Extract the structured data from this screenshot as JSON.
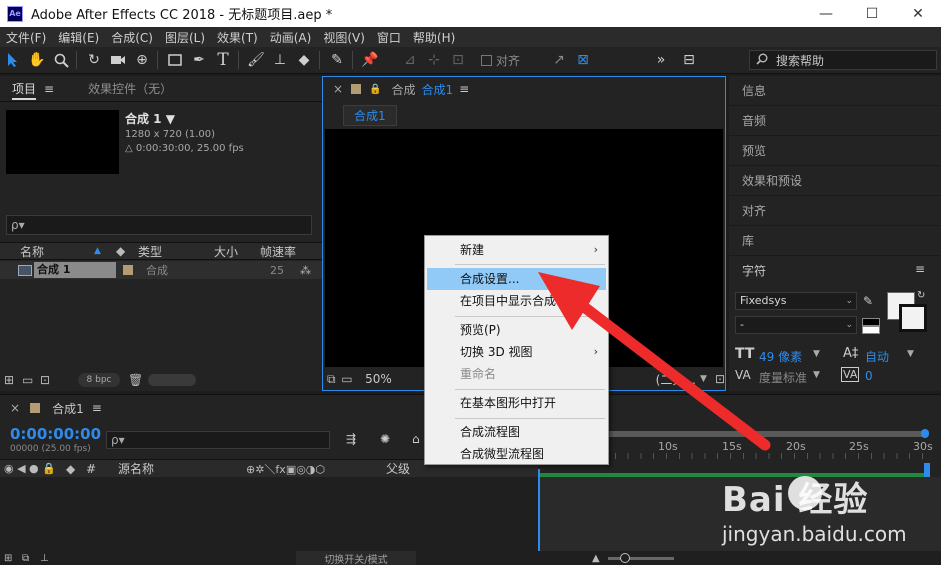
{
  "window": {
    "app_icon": "Ae",
    "title": "Adobe After Effects CC 2018 - 无标题项目.aep *",
    "controls": [
      "—",
      "☐",
      "✕"
    ]
  },
  "menubar": [
    "文件(F)",
    "编辑(E)",
    "合成(C)",
    "图层(L)",
    "效果(T)",
    "动画(A)",
    "视图(V)",
    "窗口",
    "帮助(H)"
  ],
  "toolbar": {
    "align_label": "对齐",
    "search_help": "搜索帮助"
  },
  "project_panel": {
    "tab_project": "项目",
    "tab_menu": "≡",
    "tab_effects": "效果控件（无）",
    "comp_name": "合成 1 ▼",
    "comp_res": "1280 x 720 (1.00)",
    "comp_duration": "△ 0:00:30:00, 25.00 fps",
    "search_placeholder": "ρ▾",
    "columns": [
      "名称",
      "类型",
      "大小",
      "帧速率"
    ],
    "rows": [
      {
        "name": "合成 1",
        "type": "合成",
        "size": "",
        "fps": "25"
      }
    ],
    "bpc": "8 bpc"
  },
  "comp_panel": {
    "close": "×",
    "tab_label": "合成",
    "tab_comp": "合成1",
    "tab_menu": "≡",
    "subtab": "合成1",
    "zoom": "50%",
    "resolution": "(二分..."
  },
  "right_panel": {
    "items": [
      "信息",
      "音频",
      "预览",
      "效果和预设",
      "对齐",
      "库"
    ],
    "character": {
      "title": "字符",
      "menu": "≡",
      "font": "Fixedsys",
      "style": "-",
      "size": "49 像素",
      "leading": "自动",
      "kerning": "度量标准",
      "tracking": "0"
    }
  },
  "timeline": {
    "close": "×",
    "tab": "合成1",
    "tab_menu": "≡",
    "timecode": "0:00:00:00",
    "fps": "00000 (25.00 fps)",
    "search_placeholder": "ρ▾",
    "col_hash": "#",
    "col_source": "源名称",
    "col_parent": "父级",
    "ticks": [
      "10s",
      "15s",
      "20s",
      "25s",
      "30s"
    ],
    "footer_toggle": "切换开关/模式"
  },
  "context_menu": {
    "items": [
      {
        "label": "新建",
        "submenu": true
      },
      {
        "label": "合成设置...",
        "highlighted": true
      },
      {
        "label": "在项目中显示合成"
      },
      {
        "label": "预览(P)"
      },
      {
        "label": "切换 3D 视图",
        "submenu": true
      },
      {
        "label": "重命名",
        "disabled": true
      },
      {
        "label": "在基本图形中打开"
      },
      {
        "label": "合成流程图"
      },
      {
        "label": "合成微型流程图"
      }
    ]
  },
  "watermark": {
    "brand": "Bai  经验",
    "url": "jingyan.baidu.com"
  },
  "colors": {
    "accent": "#2d8ceb",
    "arrow": "#ee2b2b",
    "menu_highlight": "#91c9f7"
  }
}
